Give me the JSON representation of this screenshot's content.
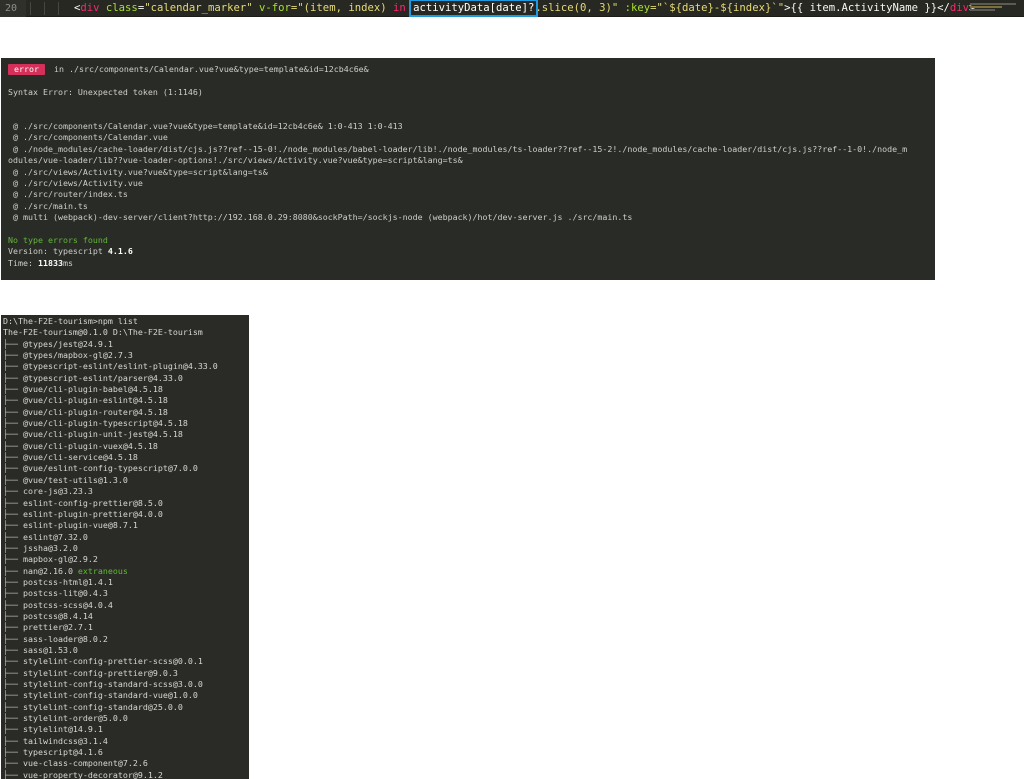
{
  "editor": {
    "line_number": "20",
    "code": {
      "indent": "",
      "open_bracket": "<",
      "tag": "div",
      "attr_class": "class",
      "eq": "=",
      "class_value": "\"calendar_marker\"",
      "attr_vfor": "v-for",
      "vfor_open": "=\"(item, index) ",
      "kw_in": "in",
      "highlight": "activityData[date]?",
      "after_highlight": ".slice(0, 3)\" ",
      "attr_key": ":key",
      "key_value": "=\"`${date}-${index}`\"",
      "mustache": ">{{ item.ActivityName }}</",
      "close_tag": "div",
      "close_bracket": ">"
    }
  },
  "error_panel": {
    "badge": "error",
    "file": " in ./src/components/Calendar.vue?vue&type=template&id=12cb4c6e&",
    "syntax_error": "Syntax Error: Unexpected token (1:1146)",
    "trace": [
      " @ ./src/components/Calendar.vue?vue&type=template&id=12cb4c6e& 1:0-413 1:0-413",
      " @ ./src/components/Calendar.vue",
      " @ ./node_modules/cache-loader/dist/cjs.js??ref--15-0!./node_modules/babel-loader/lib!./node_modules/ts-loader??ref--15-2!./node_modules/cache-loader/dist/cjs.js??ref--1-0!./node_m",
      "odules/vue-loader/lib??vue-loader-options!./src/views/Activity.vue?vue&type=script&lang=ts&",
      " @ ./src/views/Activity.vue?vue&type=script&lang=ts&",
      " @ ./src/views/Activity.vue",
      " @ ./src/router/index.ts",
      " @ ./src/main.ts",
      " @ multi (webpack)-dev-server/client?http://192.168.0.29:8080&sockPath=/sockjs-node (webpack)/hot/dev-server.js ./src/main.ts"
    ],
    "no_type_errors": "No type errors found",
    "version_label": "Version: typescript ",
    "version_value": "4.1.6",
    "time_label": "Time: ",
    "time_value": "11833",
    "time_unit": "ms"
  },
  "npm_panel": {
    "prompt": "D:\\The-F2E-tourism>npm list",
    "root": "The-F2E-tourism@0.1.0 D:\\The-F2E-tourism",
    "packages": [
      {
        "branch": "├── ",
        "name": "@types/jest@24.9.1",
        "note": ""
      },
      {
        "branch": "├── ",
        "name": "@types/mapbox-gl@2.7.3",
        "note": ""
      },
      {
        "branch": "├── ",
        "name": "@typescript-eslint/eslint-plugin@4.33.0",
        "note": ""
      },
      {
        "branch": "├── ",
        "name": "@typescript-eslint/parser@4.33.0",
        "note": ""
      },
      {
        "branch": "├── ",
        "name": "@vue/cli-plugin-babel@4.5.18",
        "note": ""
      },
      {
        "branch": "├── ",
        "name": "@vue/cli-plugin-eslint@4.5.18",
        "note": ""
      },
      {
        "branch": "├── ",
        "name": "@vue/cli-plugin-router@4.5.18",
        "note": ""
      },
      {
        "branch": "├── ",
        "name": "@vue/cli-plugin-typescript@4.5.18",
        "note": ""
      },
      {
        "branch": "├── ",
        "name": "@vue/cli-plugin-unit-jest@4.5.18",
        "note": ""
      },
      {
        "branch": "├── ",
        "name": "@vue/cli-plugin-vuex@4.5.18",
        "note": ""
      },
      {
        "branch": "├── ",
        "name": "@vue/cli-service@4.5.18",
        "note": ""
      },
      {
        "branch": "├── ",
        "name": "@vue/eslint-config-typescript@7.0.0",
        "note": ""
      },
      {
        "branch": "├── ",
        "name": "@vue/test-utils@1.3.0",
        "note": ""
      },
      {
        "branch": "├── ",
        "name": "core-js@3.23.3",
        "note": ""
      },
      {
        "branch": "├── ",
        "name": "eslint-config-prettier@8.5.0",
        "note": ""
      },
      {
        "branch": "├── ",
        "name": "eslint-plugin-prettier@4.0.0",
        "note": ""
      },
      {
        "branch": "├── ",
        "name": "eslint-plugin-vue@8.7.1",
        "note": ""
      },
      {
        "branch": "├── ",
        "name": "eslint@7.32.0",
        "note": ""
      },
      {
        "branch": "├── ",
        "name": "jssha@3.2.0",
        "note": ""
      },
      {
        "branch": "├── ",
        "name": "mapbox-gl@2.9.2",
        "note": ""
      },
      {
        "branch": "├── ",
        "name": "nan@2.16.0",
        "note": " extraneous"
      },
      {
        "branch": "├── ",
        "name": "postcss-html@1.4.1",
        "note": ""
      },
      {
        "branch": "├── ",
        "name": "postcss-lit@0.4.3",
        "note": ""
      },
      {
        "branch": "├── ",
        "name": "postcss-scss@4.0.4",
        "note": ""
      },
      {
        "branch": "├── ",
        "name": "postcss@8.4.14",
        "note": ""
      },
      {
        "branch": "├── ",
        "name": "prettier@2.7.1",
        "note": ""
      },
      {
        "branch": "├── ",
        "name": "sass-loader@8.0.2",
        "note": ""
      },
      {
        "branch": "├── ",
        "name": "sass@1.53.0",
        "note": ""
      },
      {
        "branch": "├── ",
        "name": "stylelint-config-prettier-scss@0.0.1",
        "note": ""
      },
      {
        "branch": "├── ",
        "name": "stylelint-config-prettier@9.0.3",
        "note": ""
      },
      {
        "branch": "├── ",
        "name": "stylelint-config-standard-scss@3.0.0",
        "note": ""
      },
      {
        "branch": "├── ",
        "name": "stylelint-config-standard-vue@1.0.0",
        "note": ""
      },
      {
        "branch": "├── ",
        "name": "stylelint-config-standard@25.0.0",
        "note": ""
      },
      {
        "branch": "├── ",
        "name": "stylelint-order@5.0.0",
        "note": ""
      },
      {
        "branch": "├── ",
        "name": "stylelint@14.9.1",
        "note": ""
      },
      {
        "branch": "├── ",
        "name": "tailwindcss@3.1.4",
        "note": ""
      },
      {
        "branch": "├── ",
        "name": "typescript@4.1.6",
        "note": ""
      },
      {
        "branch": "├── ",
        "name": "vue-class-component@7.2.6",
        "note": ""
      },
      {
        "branch": "├── ",
        "name": "vue-property-decorator@9.1.2",
        "note": ""
      }
    ]
  }
}
